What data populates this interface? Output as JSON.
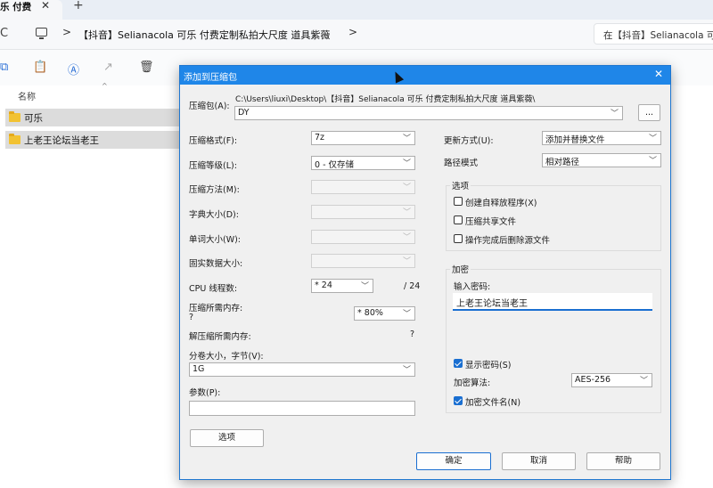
{
  "explorer": {
    "tab_title": "乐 付费",
    "tab_close": "✕",
    "tab_new": "+",
    "refresh_glyph": "C",
    "breadcrumb_sep": ">",
    "breadcrumb": "【抖音】Selianacola 可乐 付费定制私拍大尺度 道具紫薇",
    "search_placeholder": "在【抖音】Selianacola 可",
    "column_name": "名称",
    "files": [
      {
        "name": "可乐"
      },
      {
        "name": "上老王论坛当老王"
      }
    ]
  },
  "dialog": {
    "title": "添加到压缩包",
    "close": "✕",
    "archive_label": "压缩包(A):",
    "archive_path": "C:\\Users\\liuxi\\Desktop\\【抖音】Selianacola 可乐 付费定制私拍大尺度 道具紫薇\\",
    "archive_name": "DY",
    "browse_label": "...",
    "left": {
      "format_label": "压缩格式(F):",
      "format_value": "7z",
      "level_label": "压缩等级(L):",
      "level_value": "0 - 仅存储",
      "method_label": "压缩方法(M):",
      "dict_label": "字典大小(D):",
      "word_label": "单词大小(W):",
      "solid_label": "固实数据大小:",
      "threads_label": "CPU 线程数:",
      "threads_value": "* 24",
      "threads_total": "/ 24",
      "mem_comp_label": "压缩所需内存:",
      "mem_comp_q": "?",
      "mem_value": "* 80%",
      "mem_decomp_label": "解压缩所需内存:",
      "mem_decomp_q": "?",
      "volume_label": "分卷大小，字节(V):",
      "volume_value": "1G",
      "params_label": "参数(P):",
      "options_button": "选项"
    },
    "right": {
      "update_label": "更新方式(U):",
      "update_value": "添加并替换文件",
      "path_label": "路径模式",
      "path_value": "相对路径",
      "options_group": "选项",
      "opt_sfx": "创建自释放程序(X)",
      "opt_shared": "压缩共享文件",
      "opt_delete": "操作完成后删除源文件",
      "enc_group": "加密",
      "pwd_label": "输入密码:",
      "pwd_value": "上老王论坛当老王",
      "show_pwd": "显示密码(S)",
      "enc_method_label": "加密算法:",
      "enc_method_value": "AES-256",
      "enc_names": "加密文件名(N)"
    },
    "ok": "确定",
    "cancel": "取消",
    "help": "帮助"
  }
}
